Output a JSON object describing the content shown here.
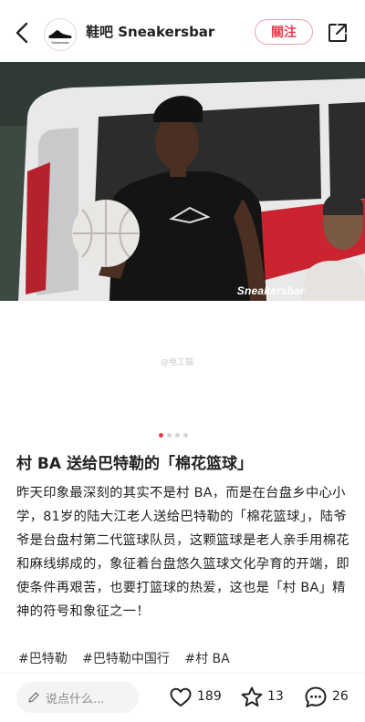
{
  "header": {
    "title": "鞋吧 Sneakersbar",
    "avatar_text": "Sneakersbar",
    "follow_label": "關注"
  },
  "photo": {
    "watermark": "Sneakersbar",
    "sub_watermark": "@电工猫"
  },
  "carousel": {
    "count": 4,
    "active": 0
  },
  "post": {
    "title": "村 BA 送给巴特勒的「棉花篮球」",
    "body": "昨天印象最深刻的其实不是村 BA，而是在台盘乡中心小学，81岁的陆大江老人送给巴特勒的「棉花篮球」，陆爷爷是台盘村第二代篮球队员，这颗篮球是老人亲手用棉花和麻线绑成的，象征着台盘悠久篮球文化孕育的开端，即使条件再艰苦，也要打篮球的热爱，这也是「村 BA」精神的符号和象征之一！",
    "tags": [
      "#巴特勒",
      "#巴特勒中国行",
      "#村 BA"
    ]
  },
  "bottom_bar": {
    "comment_placeholder": "说点什么...",
    "likes": "189",
    "favorites": "13",
    "comments": "26"
  },
  "colors": {
    "accent": "#ec3b4e"
  }
}
